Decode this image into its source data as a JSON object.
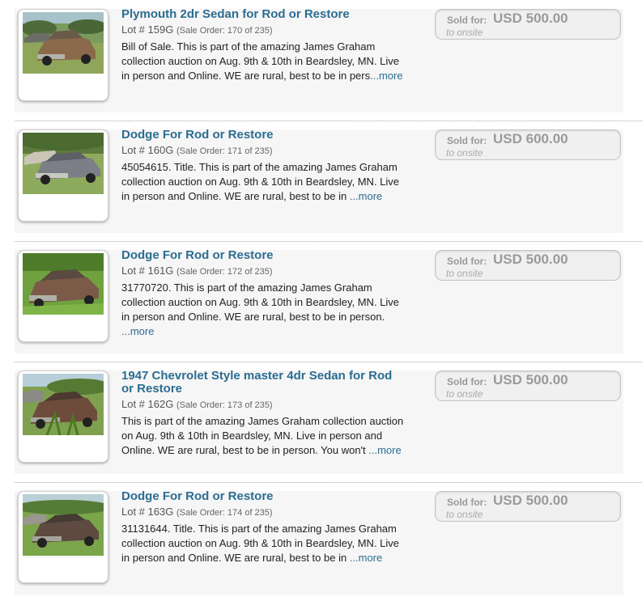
{
  "lots": [
    {
      "title": "Plymouth 2dr Sedan for Rod or Restore",
      "lot_number": "Lot # 159G",
      "sale_order": "(Sale Order: 170 of 235)",
      "description": "Bill of Sale. This is part of the amazing James Graham collection auction on Aug. 9th & 10th in Beardsley, MN. Live in person and Online. WE are rural, best to be in pers",
      "more": "...more",
      "sold_label": "Sold for:",
      "price": "USD 500.00",
      "to": "to onsite"
    },
    {
      "title": "Dodge For Rod or Restore",
      "lot_number": "Lot # 160G",
      "sale_order": "(Sale Order: 171 of 235)",
      "description": "45054615. Title. This is part of the amazing James Graham collection auction on Aug. 9th & 10th in Beardsley, MN. Live in person and Online. WE are rural, best to be in ",
      "more": "...more",
      "sold_label": "Sold for:",
      "price": "USD 600.00",
      "to": "to onsite"
    },
    {
      "title": "Dodge For Rod or Restore",
      "lot_number": "Lot # 161G",
      "sale_order": "(Sale Order: 172 of 235)",
      "description": "31770720. This is part of the amazing James Graham collection auction on Aug. 9th & 10th in Beardsley, MN. Live in person and Online. WE are rural, best to be in person. ",
      "more": "...more",
      "sold_label": "Sold for:",
      "price": "USD 500.00",
      "to": "to onsite"
    },
    {
      "title": "1947 Chevrolet Style master 4dr Sedan for Rod or Restore",
      "lot_number": "Lot # 162G",
      "sale_order": "(Sale Order: 173 of 235)",
      "description": "This is part of the amazing James Graham collection auction on Aug. 9th & 10th in Beardsley, MN. Live in person and Online. WE are rural, best to be in person. You won't ",
      "more": "...more",
      "sold_label": "Sold for:",
      "price": "USD 500.00",
      "to": "to onsite"
    },
    {
      "title": "Dodge For Rod or Restore",
      "lot_number": "Lot # 163G",
      "sale_order": "(Sale Order: 174 of 235)",
      "description": "31131644. Title. This is part of the amazing James Graham collection auction on Aug. 9th & 10th in Beardsley, MN. Live in person and Online. WE are rural, best to be in ",
      "more": "...more",
      "sold_label": "Sold for:",
      "price": "USD 500.00",
      "to": "to onsite"
    }
  ],
  "colors": {
    "link": "#2b6d91",
    "row_bg": "#f6f6f6",
    "price_text": "#9a9a9a"
  },
  "icons": [
    "car-photo"
  ]
}
